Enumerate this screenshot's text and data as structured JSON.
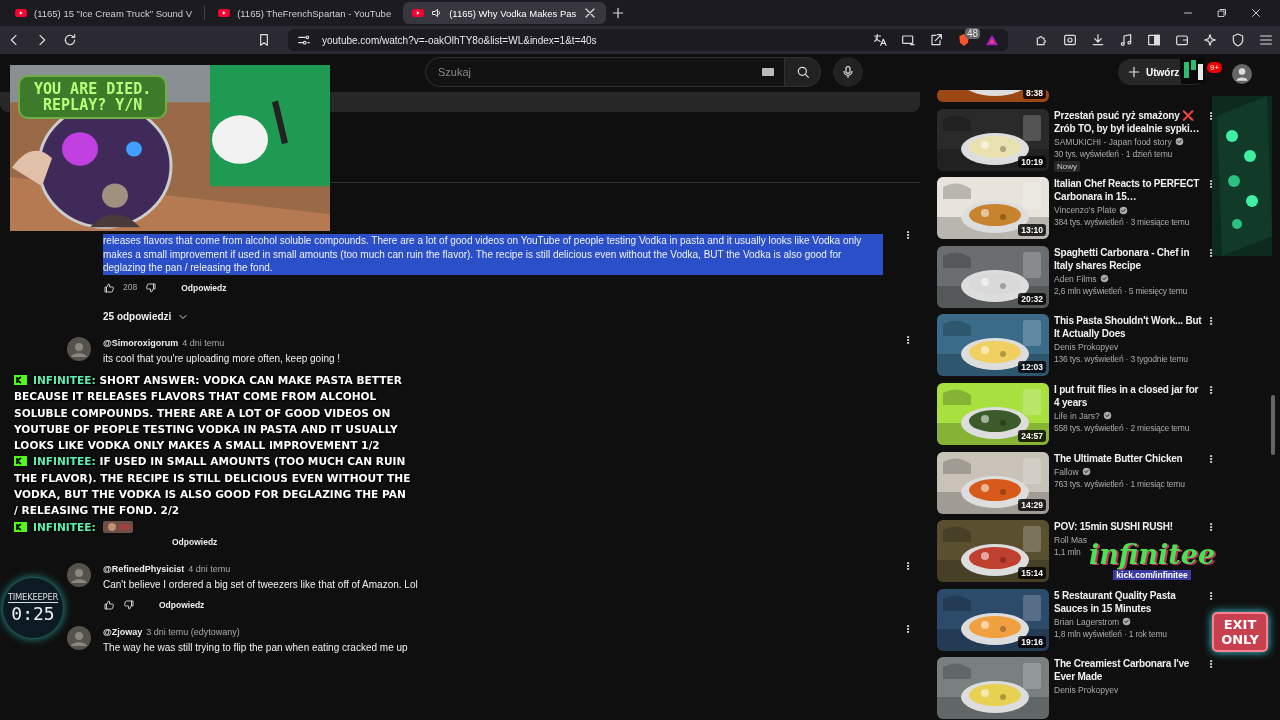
{
  "browser": {
    "tabs": [
      {
        "title": "(1165) 15 \"Ice Cream Truck\" Sound V",
        "selected": false,
        "audio": false
      },
      {
        "title": "(1165) TheFrenchSpartan - YouTube",
        "selected": false,
        "audio": false
      },
      {
        "title": "(1165) Why Vodka Makes Pas",
        "selected": true,
        "audio": true
      }
    ],
    "url": "youtube.com/watch?v=-oakOlhTY8o&list=WL&index=1&t=40s",
    "shield_count": "48"
  },
  "header": {
    "search_placeholder": "Szukaj",
    "create_label": "Utwórz",
    "notifications": "9+"
  },
  "comments": [
    {
      "kind": "full",
      "text": "releases flavors that come from alcohol soluble compounds. There are a lot of good videos on YouTube of people testing Vodka in pasta and it usually looks like Vodka only makes a small improvement if used in small amounts (too much can ruin the flavor). The recipe is still delicious even without the Vodka, BUT the Vodka is also good for deglazing the pan / releasing the fond.",
      "selected": true,
      "likes": "208",
      "reply_label": "Odpowiedz",
      "replies": "25 odpowiedzi"
    },
    {
      "kind": "full",
      "author": "@Simoroxigorum",
      "time": "4 dni temu",
      "text": "its cool that you're uploading more often, keep going !",
      "selected": false
    },
    {
      "kind": "hidden",
      "reply_label": "Odpowiedz"
    },
    {
      "kind": "full",
      "author": "@RefinedPhysicist",
      "time": "4 dni temu",
      "text": "Can't believe I ordered a big set of tweezers like that off of Amazon. Lol",
      "selected": false,
      "reply_label": "Odpowiedz"
    },
    {
      "kind": "full",
      "author": "@Zjoway",
      "time": "3 dni temu (edytowany)",
      "text": "The way he was still trying to flip the pan when eating cracked me up",
      "selected": false
    }
  ],
  "sidebar": {
    "videos": [
      {
        "kind": "partial",
        "duration": "8:38"
      },
      {
        "kind": "full",
        "title": "Przestań psuć ryż smażony ❌ Zrób TO, by był idealnie sypki…",
        "channel": "SAMUKICHI - Japan food story",
        "verified": true,
        "meta": "30 tys. wyświetleń · 1 dzień temu",
        "badge": "Nowy",
        "duration": "10:19"
      },
      {
        "kind": "full",
        "title": "Italian Chef Reacts to PERFECT Carbonara in 15…",
        "channel": "Vincenzo's Plate",
        "verified": true,
        "meta": "384 tys. wyświetleń · 3 miesiące temu",
        "duration": "13:10"
      },
      {
        "kind": "full",
        "title": "Spaghetti Carbonara - Chef in Italy shares Recipe",
        "channel": "Aden Films",
        "verified": true,
        "meta": "2,6 mln wyświetleń · 5 miesięcy temu",
        "duration": "20:32"
      },
      {
        "kind": "full",
        "title": "This Pasta Shouldn't Work... But It Actually Does",
        "channel": "Denis Prokopyev",
        "verified": false,
        "meta": "136 tys. wyświetleń · 3 tygodnie temu",
        "duration": "12:03"
      },
      {
        "kind": "full",
        "title": "I put fruit flies in a closed jar for 4 years",
        "channel": "Life in Jars?",
        "verified": true,
        "meta": "558 tys. wyświetleń · 2 miesiące temu",
        "duration": "24:57"
      },
      {
        "kind": "full",
        "title": "The Ultimate Butter Chicken",
        "channel": "Fallow",
        "verified": true,
        "meta": "763 tys. wyświetleń · 1 miesiąc temu",
        "duration": "14:29"
      },
      {
        "kind": "full",
        "title": "POV: 15min SUSHI RUSH!",
        "channel": "Roll Mas",
        "verified": false,
        "meta": "1,1 mln",
        "duration": "15:14"
      },
      {
        "kind": "full",
        "title": "5 Restaurant Quality Pasta Sauces in 15 Minutes",
        "channel": "Brian Lagerstrom",
        "verified": true,
        "meta": "1,8 mln wyświetleń · 1 rok temu",
        "duration": "19:16"
      },
      {
        "kind": "full",
        "title": "The Creamiest Carbonara I've Ever Made",
        "channel": "Denis Prokopyev",
        "verified": false
      }
    ]
  },
  "overlays": {
    "webcam_caption": [
      "YOU ARE DIED.",
      "REPLAY? Y/N"
    ],
    "chat": [
      {
        "user": "INFINITEE:",
        "text": "SHORT ANSWER: VODKA CAN MAKE PASTA BETTER BECAUSE IT RELEASES FLAVORS THAT COME FROM ALCOHOL SOLUBLE COMPOUNDS. THERE ARE A LOT OF GOOD VIDEOS ON YOUTUBE OF PEOPLE TESTING VODKA IN PASTA AND IT USUALLY LOOKS LIKE VODKA ONLY MAKES A SMALL IMPROVEMENT 1/2",
        "emote": false
      },
      {
        "user": "INFINITEE:",
        "text": "IF USED IN SMALL AMOUNTS (TOO MUCH CAN RUIN THE FLAVOR). THE RECIPE IS STILL DELICIOUS EVEN WITHOUT THE VODKA, BUT THE VODKA IS ALSO GOOD FOR DEGLAZING THE PAN / RELEASING THE FOND. 2/2",
        "emote": false
      },
      {
        "user": "INFINITEE:",
        "emote": true
      }
    ],
    "timer": {
      "label": "TIMEKEEPER",
      "time": "0:25"
    },
    "logo": {
      "name": "infinitee",
      "link": "kick.com/infinitee"
    },
    "sign": [
      "EXIT",
      "ONLY"
    ]
  }
}
